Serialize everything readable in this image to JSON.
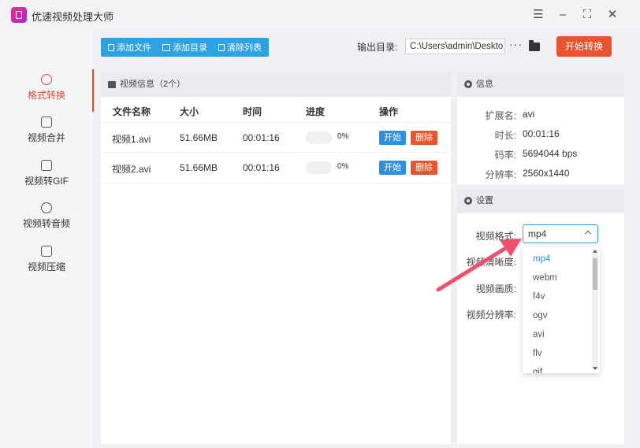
{
  "app": {
    "title": "优速视频处理大师",
    "brand_color": "#e04b2c"
  },
  "window": {
    "menu_icon": "menu-icon",
    "minimize_icon": "minimize-icon",
    "maximize_icon": "maximize-icon",
    "close_icon": "close-icon"
  },
  "sidebar": {
    "items": [
      {
        "label": "格式转换",
        "icon": "format-convert-icon",
        "active": true
      },
      {
        "label": "视频合并",
        "icon": "merge-icon"
      },
      {
        "label": "视频转GIF",
        "icon": "gif-icon"
      },
      {
        "label": "视频转音频",
        "icon": "audio-icon"
      },
      {
        "label": "视频压缩",
        "icon": "compress-icon"
      }
    ]
  },
  "toolbar": {
    "add_file": "添加文件",
    "add_dir": "添加目录",
    "clear_list": "清除列表",
    "output_label": "输出目录:",
    "output_path": "C:\\Users\\admin\\Deskto",
    "more": "···",
    "start": "开始转换"
  },
  "video_panel": {
    "title": "视频信息（2个）",
    "columns": [
      "文件名称",
      "大小",
      "时间",
      "进度",
      "操作"
    ],
    "rows": [
      {
        "name": "视频1.avi",
        "size": "51.66MB",
        "time": "00:01:16",
        "progress": "0%",
        "start": "开始",
        "delete": "删除"
      },
      {
        "name": "视频2.avi",
        "size": "51.66MB",
        "time": "00:01:16",
        "progress": "0%",
        "start": "开始",
        "delete": "删除"
      }
    ]
  },
  "info_panel": {
    "title": "信息",
    "fields": [
      {
        "key": "扩展名:",
        "value": "avi"
      },
      {
        "key": "时长:",
        "value": "00:01:16"
      },
      {
        "key": "码率:",
        "value": "5694044 bps"
      },
      {
        "key": "分辨率:",
        "value": "2560x1440"
      }
    ]
  },
  "settings_panel": {
    "title": "设置",
    "labels": [
      "视频格式:",
      "视频清晰度:",
      "视频画质:",
      "视频分辨率:"
    ],
    "format_selected": "mp4",
    "format_options": [
      "mp4",
      "webm",
      "f4v",
      "ogv",
      "avi",
      "flv",
      "gif"
    ]
  },
  "colors": {
    "accent_blue": "#2ea1e0",
    "accent_orange": "#e9542e",
    "arrow": "#f0506e"
  }
}
